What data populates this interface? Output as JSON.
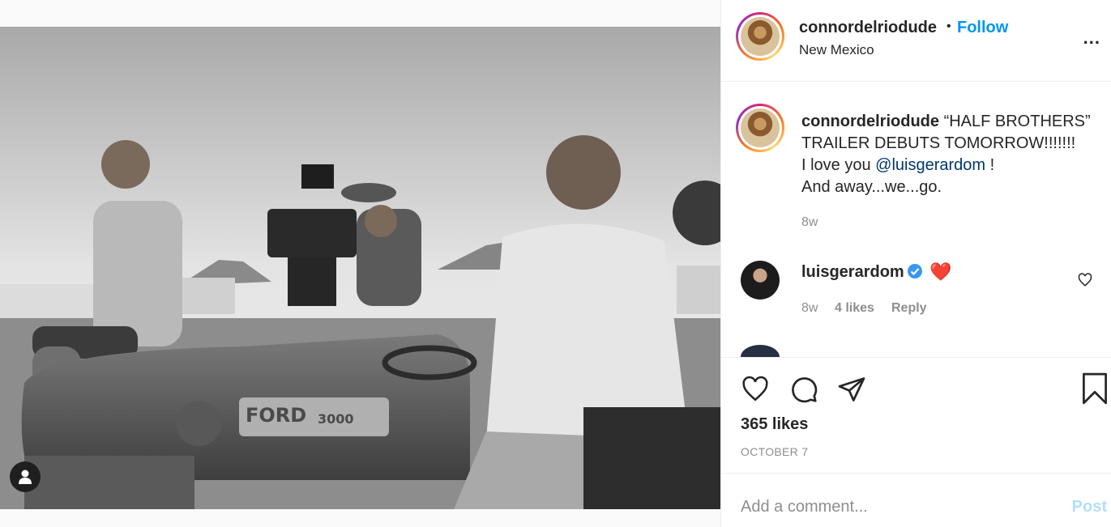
{
  "header": {
    "username": "connordelriodude",
    "separator": "•",
    "follow_label": "Follow",
    "location": "New Mexico",
    "more_label": "..."
  },
  "caption": {
    "username": "connordelriodude",
    "line1": "“HALF BROTHERS” TRAILER DEBUTS TOMORROW!!!!!!!",
    "line2_prefix": "I love you ",
    "mention": "@luisgerardom",
    "line2_suffix": " !",
    "line3": "And away...we...go.",
    "time": "8w"
  },
  "comments": [
    {
      "username": "luisgerardom",
      "verified": true,
      "text": "❤️",
      "time": "8w",
      "likes": "4 likes",
      "reply_label": "Reply"
    }
  ],
  "actions": {
    "likes": "365 likes",
    "date": "OCTOBER 7"
  },
  "composer": {
    "placeholder": "Add a comment...",
    "post_label": "Post"
  },
  "photo": {
    "tractor_text": "FORD",
    "tractor_model": "3000"
  },
  "colors": {
    "accent": "#0095f6",
    "mention": "#00376b",
    "muted": "#8e8e8e",
    "heart": "#ed4956",
    "verified": "#3897f0"
  }
}
